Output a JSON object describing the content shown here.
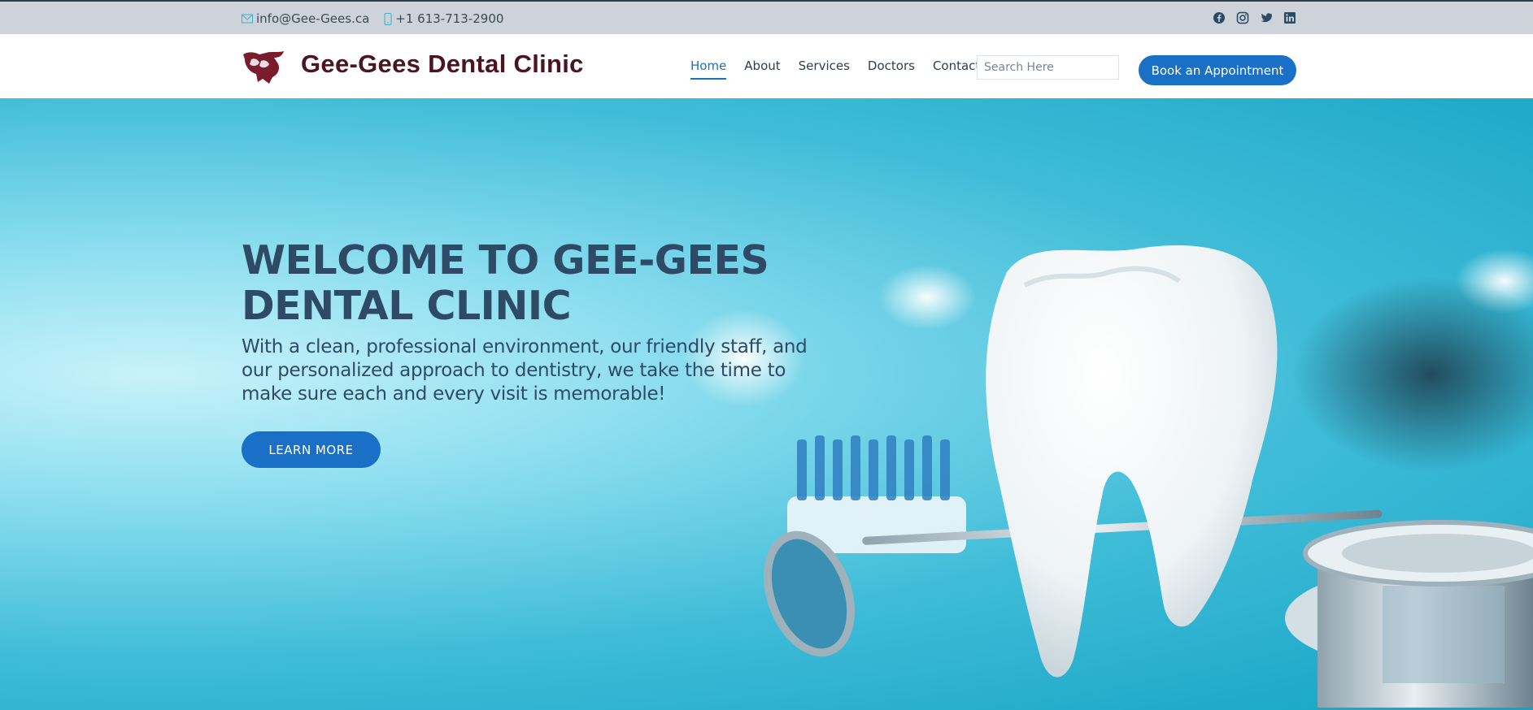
{
  "topbar": {
    "email": "info@Gee-Gees.ca",
    "phone": "+1 613-713-2900",
    "social": [
      "facebook-icon",
      "instagram-icon",
      "twitter-icon",
      "linkedin-icon"
    ]
  },
  "header": {
    "brand": "Gee-Gees Dental Clinic",
    "nav": [
      {
        "label": "Home",
        "active": true
      },
      {
        "label": "About",
        "active": false
      },
      {
        "label": "Services",
        "active": false
      },
      {
        "label": "Doctors",
        "active": false
      },
      {
        "label": "Contact",
        "active": false
      }
    ],
    "search_placeholder": "Search Here",
    "book_label": "Book an Appointment"
  },
  "hero": {
    "title": "WELCOME TO GEE-GEES DENTAL CLINIC",
    "text": "With a clean, professional environment, our friendly staff, and our personalized approach to dentistry, we take the time to make sure each and every visit is memorable!",
    "button_label": "LEARN MORE"
  },
  "colors": {
    "accent": "#1a6fc7",
    "brand": "#4a1420",
    "heading": "#2e4a66",
    "topbar_bg": "#cdd3d8"
  }
}
